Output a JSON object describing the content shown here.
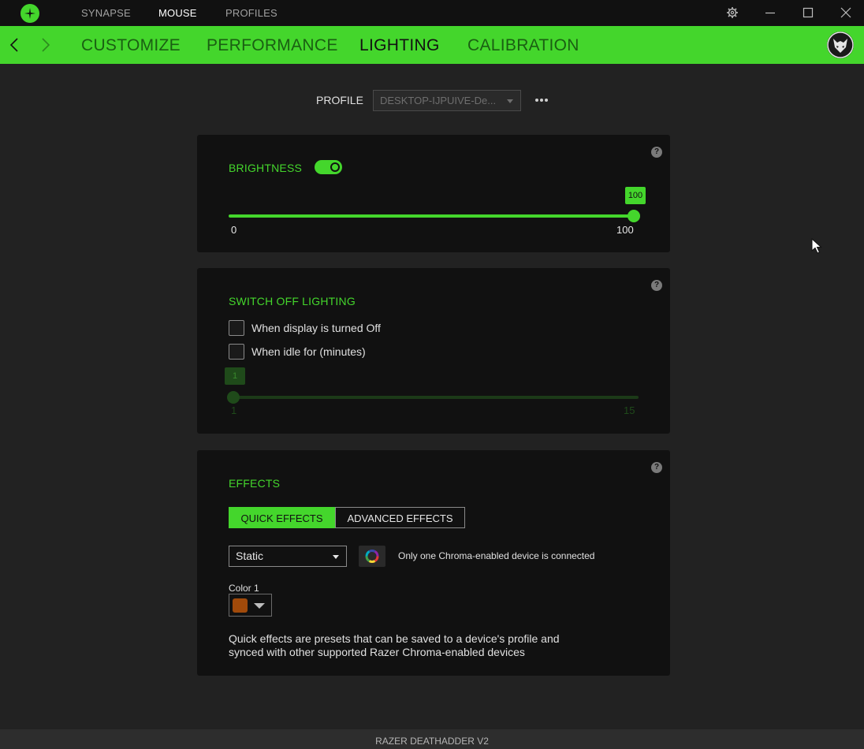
{
  "titlebar": {
    "nav": [
      "SYNAPSE",
      "MOUSE",
      "PROFILES"
    ],
    "active_nav": "MOUSE"
  },
  "tabs": [
    "CUSTOMIZE",
    "PERFORMANCE",
    "LIGHTING",
    "CALIBRATION"
  ],
  "active_tab": "LIGHTING",
  "profile": {
    "label": "PROFILE",
    "value": "DESKTOP-IJPUIVE-De..."
  },
  "brightness": {
    "title": "BRIGHTNESS",
    "enabled": true,
    "value": "100",
    "min_label": "0",
    "max_label": "100",
    "level": 1.0
  },
  "switch_off": {
    "title": "SWITCH OFF LIGHTING",
    "display_off_label": "When display is turned Off",
    "idle_label": "When idle for (minutes)",
    "idle_value": "1",
    "idle_min_label": "1",
    "idle_max_label": "15"
  },
  "effects": {
    "title": "EFFECTS",
    "quick_label": "QUICK EFFECTS",
    "advanced_label": "ADVANCED EFFECTS",
    "effect_value": "Static",
    "chroma_note": "Only one Chroma-enabled device is connected",
    "color_label": "Color 1",
    "color_value": "#a14a0a",
    "description_line1": "Quick effects are presets that can be saved to a device's profile and",
    "description_line2": "synced with other supported Razer Chroma-enabled devices"
  },
  "footer": {
    "device_name": "RAZER DEATHADDER V2"
  },
  "colors": {
    "accent": "#44d62c",
    "background": "#222222",
    "card": "#111111"
  }
}
